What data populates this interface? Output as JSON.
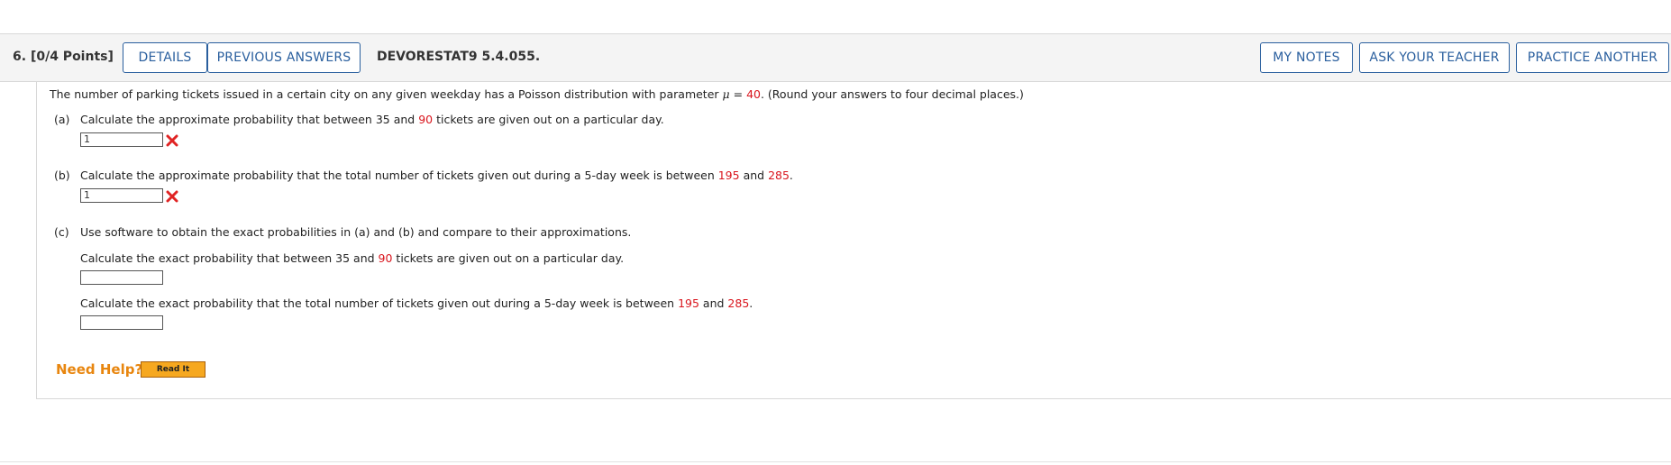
{
  "header": {
    "question_number": "6.",
    "points": "[0/4 Points]",
    "details_label": "DETAILS",
    "previous_answers_label": "PREVIOUS ANSWERS",
    "problem_code": "DEVORESTAT9 5.4.055.",
    "my_notes_label": "MY NOTES",
    "ask_teacher_label": "ASK YOUR TEACHER",
    "practice_another_label": "PRACTICE ANOTHER"
  },
  "intro": {
    "before": "The number of parking tickets issued in a certain city on any given weekday has a Poisson distribution with parameter ",
    "mu_symbol": "μ",
    "equals": " = ",
    "mu_value": "40",
    "after": ". (Round your answers to four decimal places.)"
  },
  "part_a": {
    "label": "(a)",
    "text_before": "Calculate the approximate probability that between 35 and ",
    "red_value": "90",
    "text_after": " tickets are given out on a particular day.",
    "answer": "1"
  },
  "part_b": {
    "label": "(b)",
    "text_before": "Calculate the approximate probability that the total number of tickets given out during a 5-day week is between ",
    "red_value_1": "195",
    "middle": " and ",
    "red_value_2": "285",
    "text_after": ".",
    "answer": "1"
  },
  "part_c": {
    "label": "(c)",
    "text": "Use software to obtain the exact probabilities in (a) and (b) and compare to their approximations.",
    "q1_before": "Calculate the exact probability that between 35 and ",
    "q1_red": "90",
    "q1_after": " tickets are given out on a particular day.",
    "q1_answer": "",
    "q2_before": "Calculate the exact probability that the total number of tickets given out during a 5-day week is between ",
    "q2_red_1": "195",
    "q2_middle": " and ",
    "q2_red_2": "285",
    "q2_after": ".",
    "q2_answer": ""
  },
  "help": {
    "need_help": "Need Help?",
    "read_it": "Read It"
  },
  "colors": {
    "accent_blue": "#2a5f9e",
    "error_red": "#d9161e",
    "help_orange": "#e8860f",
    "read_it_button": "#f6a820"
  }
}
